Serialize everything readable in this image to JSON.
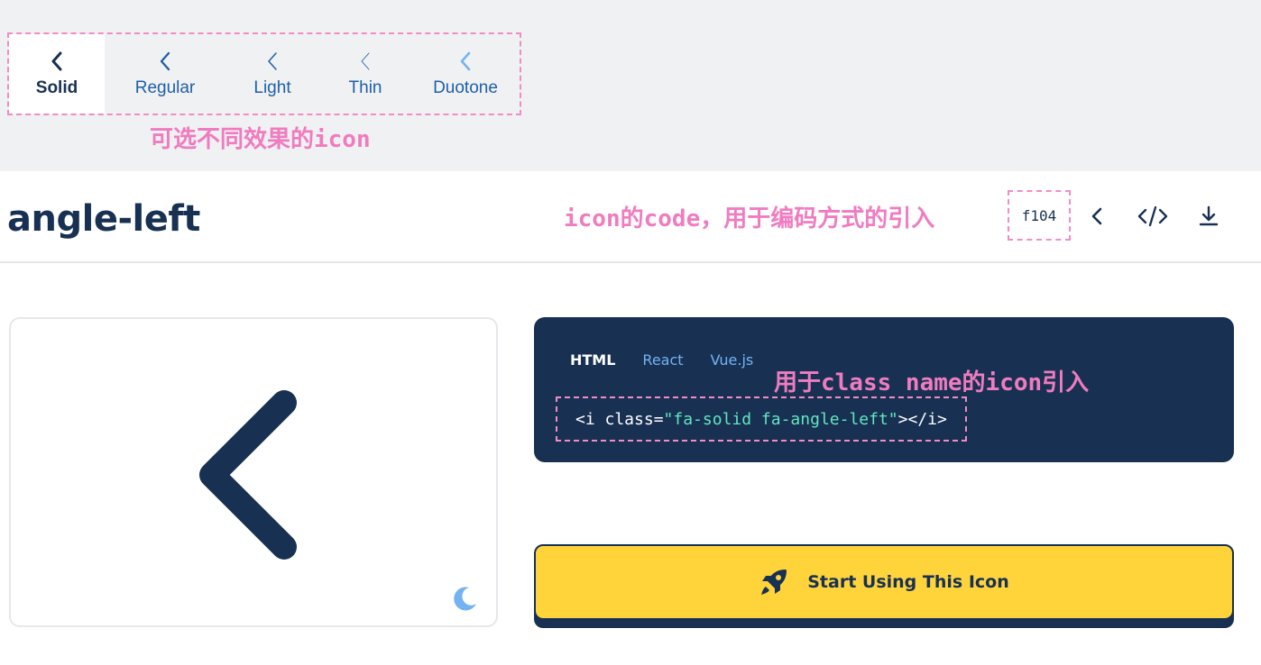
{
  "style_tabs": [
    {
      "label": "Solid",
      "active": true
    },
    {
      "label": "Regular",
      "active": false
    },
    {
      "label": "Light",
      "active": false
    },
    {
      "label": "Thin",
      "active": false
    },
    {
      "label": "Duotone",
      "active": false
    }
  ],
  "annotations": {
    "styles": "可选不同效果的icon",
    "code": "icon的code，用于编码方式的引入",
    "class_name": "用于class name的icon引入"
  },
  "icon": {
    "name": "angle-left",
    "unicode": "f104"
  },
  "header_icons": [
    "angle-left-icon",
    "code-icon",
    "download-icon"
  ],
  "code_panel": {
    "tabs": [
      {
        "label": "HTML",
        "active": true
      },
      {
        "label": "React",
        "active": false
      },
      {
        "label": "Vue.js",
        "active": false
      }
    ],
    "snippet_open": "<i class=",
    "snippet_value": "\"fa-solid fa-angle-left\"",
    "snippet_close": "></i>"
  },
  "cta": {
    "label": "Start Using This Icon",
    "icon": "rocket-icon"
  },
  "preview": {
    "theme_toggle_icon": "moon-icon"
  },
  "colors": {
    "navy": "#183153",
    "accent_blue": "#74b3f2",
    "yellow": "#ffd43b",
    "annotation_pink": "#f07cc0",
    "code_string": "#63e6be"
  }
}
